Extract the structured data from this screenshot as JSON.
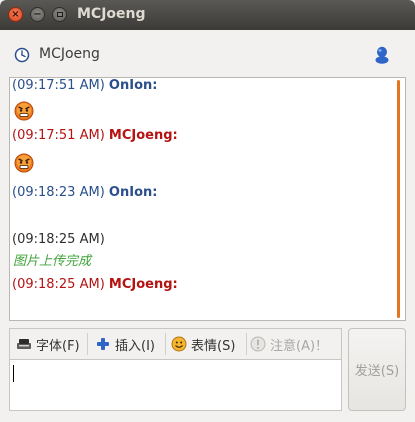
{
  "window": {
    "title": "MCJoeng",
    "close_glyph": "×",
    "minimize_glyph": "−"
  },
  "contact": {
    "name": "MCJoeng",
    "status_icon": "clock-icon",
    "profile_icon": "person-icon"
  },
  "chat": {
    "messages": [
      {
        "timestamp": "(09:17:51 AM)",
        "sender": "OnIon:",
        "color": "#2a4f8c",
        "content": "emoticon-angry"
      },
      {
        "timestamp": "(09:17:51 AM)",
        "sender": "MCJoeng:",
        "color": "#b51212",
        "content": "emoticon-angry"
      },
      {
        "timestamp": "(09:18:23 AM)",
        "sender": "OnIon:",
        "color": "#2a4f8c",
        "content": ""
      },
      {
        "timestamp": "(09:18:25 AM)",
        "sender": "",
        "color": "#2f2f2f",
        "content": "图片上传完成"
      },
      {
        "timestamp": "(09:18:25 AM)",
        "sender": "MCJoeng:",
        "color": "#b51212",
        "content": ""
      }
    ],
    "scrollbar_color": "#e2751e"
  },
  "toolbar": {
    "font_label": "字体(F)",
    "insert_label": "插入(I)",
    "emoticon_label": "表情(S)",
    "attention_label": "注意(A)！"
  },
  "input": {
    "value": ""
  },
  "send": {
    "label": "发送(S)"
  }
}
